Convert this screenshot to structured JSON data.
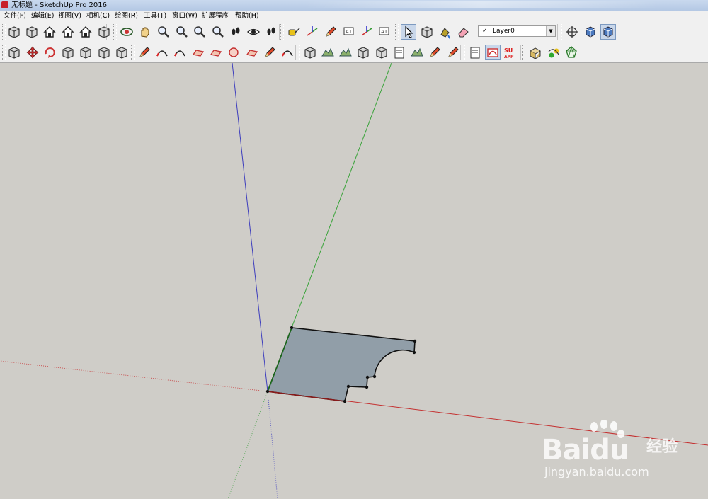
{
  "window": {
    "title": "无标题 - SketchUp Pro 2016"
  },
  "menu": [
    {
      "label": "文件(F)",
      "name": "menu-file"
    },
    {
      "label": "编辑(E)",
      "name": "menu-edit"
    },
    {
      "label": "视图(V)",
      "name": "menu-view"
    },
    {
      "label": "相机(C)",
      "name": "menu-camera"
    },
    {
      "label": "绘图(R)",
      "name": "menu-draw"
    },
    {
      "label": "工具(T)",
      "name": "menu-tools"
    },
    {
      "label": "窗口(W)",
      "name": "menu-window"
    },
    {
      "label": "扩展程序",
      "name": "menu-extensions"
    },
    {
      "label": "帮助(H)",
      "name": "menu-help"
    }
  ],
  "toolbar1": [
    {
      "icon": "iso-view-icon"
    },
    {
      "icon": "right-view-icon"
    },
    {
      "icon": "front-view-icon"
    },
    {
      "icon": "top-view-icon"
    },
    {
      "icon": "back-view-icon"
    },
    {
      "icon": "left-view-icon"
    },
    {
      "icon": "orbit-icon"
    },
    {
      "icon": "pan-icon"
    },
    {
      "icon": "zoom-icon"
    },
    {
      "icon": "zoom-window-icon"
    },
    {
      "icon": "zoom-extents-icon"
    },
    {
      "icon": "previous-view-icon"
    },
    {
      "icon": "position-camera-icon"
    },
    {
      "icon": "look-around-icon"
    },
    {
      "icon": "walk-icon"
    },
    {
      "icon": "tape-measure-icon"
    },
    {
      "icon": "dimension-icon"
    },
    {
      "icon": "protractor-icon"
    },
    {
      "icon": "text-icon"
    },
    {
      "icon": "axes-icon"
    },
    {
      "icon": "3d-text-icon"
    },
    {
      "icon": "select-icon"
    },
    {
      "icon": "make-component-icon"
    },
    {
      "icon": "paint-bucket-icon"
    },
    {
      "icon": "eraser-icon"
    },
    {
      "icon": "layer-manager-icon"
    },
    {
      "icon": "section-plane-icon"
    },
    {
      "icon": "section-display-icon"
    }
  ],
  "toolbar2": [
    {
      "icon": "push-pull-icon"
    },
    {
      "icon": "move-icon"
    },
    {
      "icon": "rotate-icon"
    },
    {
      "icon": "follow-me-icon"
    },
    {
      "icon": "scale-icon"
    },
    {
      "icon": "offset-icon"
    },
    {
      "icon": "outer-shell-icon"
    },
    {
      "icon": "line-icon"
    },
    {
      "icon": "arc-icon"
    },
    {
      "icon": "pie-icon"
    },
    {
      "icon": "rectangle-icon"
    },
    {
      "icon": "rotated-rectangle-icon"
    },
    {
      "icon": "circle-icon"
    },
    {
      "icon": "polygon-icon"
    },
    {
      "icon": "freehand-icon"
    },
    {
      "icon": "two-point-arc-icon"
    },
    {
      "icon": "sandbox-icon"
    },
    {
      "icon": "contour-icon"
    },
    {
      "icon": "stamp-icon"
    },
    {
      "icon": "drape-icon"
    },
    {
      "icon": "add-detail-icon"
    },
    {
      "icon": "flip-edge-icon"
    },
    {
      "icon": "smoove-icon"
    },
    {
      "icon": "from-scratch-icon"
    },
    {
      "icon": "model-info-icon"
    },
    {
      "icon": "3d-warehouse-icon"
    },
    {
      "icon": "extension-warehouse-icon"
    },
    {
      "icon": "su-app-icon"
    },
    {
      "icon": "solid-tools-icon"
    },
    {
      "icon": "tag-tool-icon"
    },
    {
      "icon": "geo-location-icon"
    }
  ],
  "layer": {
    "check": "✓",
    "current": "Layer0"
  },
  "watermark": {
    "logo": "Bai",
    "logo2": "du",
    "jy": "经验",
    "url": "jingyan.baidu.com"
  }
}
